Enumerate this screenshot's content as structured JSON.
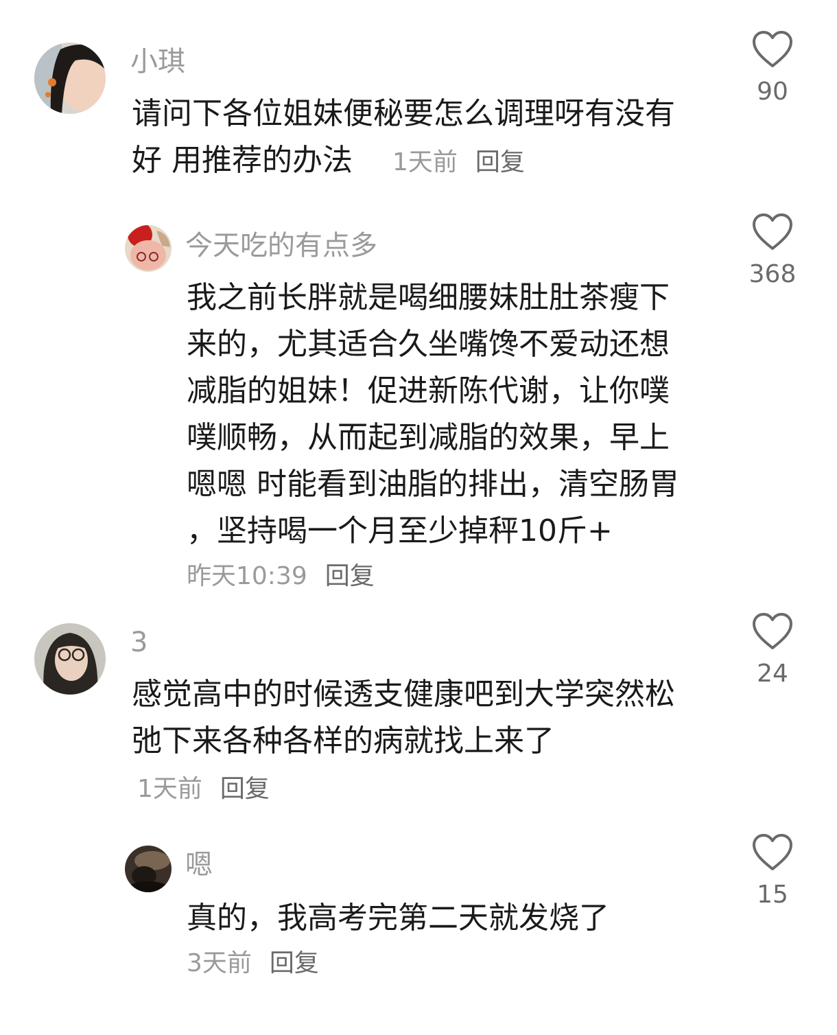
{
  "comments": [
    {
      "username": "小琪",
      "text_lines": [
        "请问下各位姐妹便秘要怎么调理呀有没有",
        "好 用推荐的办法"
      ],
      "time": "1天前",
      "reply_label": "回复",
      "likes": "90"
    },
    {
      "username": "今天吃的有点多",
      "text_lines": [
        "我之前长胖就是喝细腰妹肚肚茶瘦下",
        "来的，尤其适合久坐嘴馋不爱动还想",
        "减脂的姐妹！促进新陈代谢，让你噗",
        "噗顺畅，从而起到减脂的效果，早上",
        "嗯嗯 时能看到油脂的排出，清空肠胃",
        "，坚持喝一个月至少掉秤10斤+"
      ],
      "time": "昨天10:39",
      "reply_label": "回复",
      "likes": "368"
    },
    {
      "username": "3",
      "text_lines": [
        "感觉高中的时候透支健康吧到大学突然松",
        "弛下来各种各样的病就找上来了"
      ],
      "time": "1天前",
      "reply_label": "回复",
      "likes": "24"
    },
    {
      "username": "嗯",
      "text_lines": [
        "真的，我高考完第二天就发烧了"
      ],
      "time": "3天前",
      "reply_label": "回复",
      "likes": "15"
    }
  ],
  "icons": {
    "like": "heart-outline-icon"
  },
  "colors": {
    "username": "#9a9a9a",
    "text": "#1a1a1a",
    "meta": "#9a9a9a",
    "icon": "#6a6a6a"
  }
}
